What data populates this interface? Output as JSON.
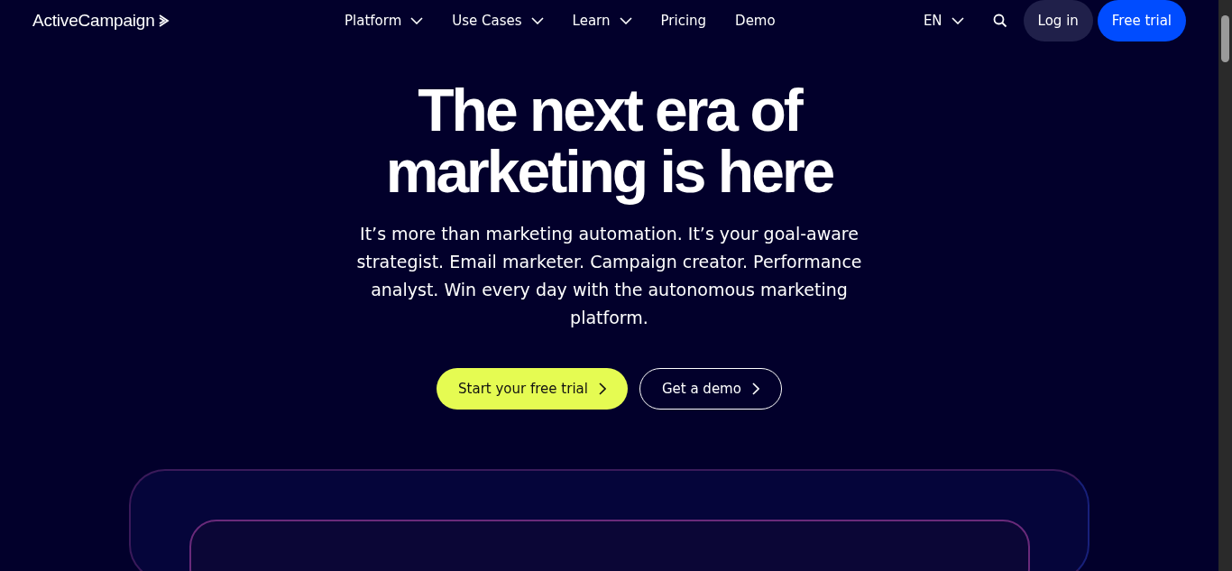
{
  "header": {
    "logo": "ActiveCampaign",
    "nav": [
      {
        "label": "Platform",
        "kind": "dropdown"
      },
      {
        "label": "Use Cases",
        "kind": "dropdown"
      },
      {
        "label": "Learn",
        "kind": "dropdown"
      },
      {
        "label": "Pricing",
        "kind": "link"
      },
      {
        "label": "Demo",
        "kind": "link"
      }
    ],
    "language": "EN",
    "login": "Log in",
    "cta": "Free trial"
  },
  "hero": {
    "title_lines": [
      "The next era of",
      "marketing is here"
    ],
    "text": "It’s more than marketing automation. It’s your goal-aware strategist. Email marketer. Campaign creator. Performance analyst. Win every day with the autonomous marketing platform.",
    "buttons": [
      {
        "label": "Start your free trial",
        "kind": "primary"
      },
      {
        "label": "Get a demo",
        "kind": "outline"
      }
    ]
  }
}
